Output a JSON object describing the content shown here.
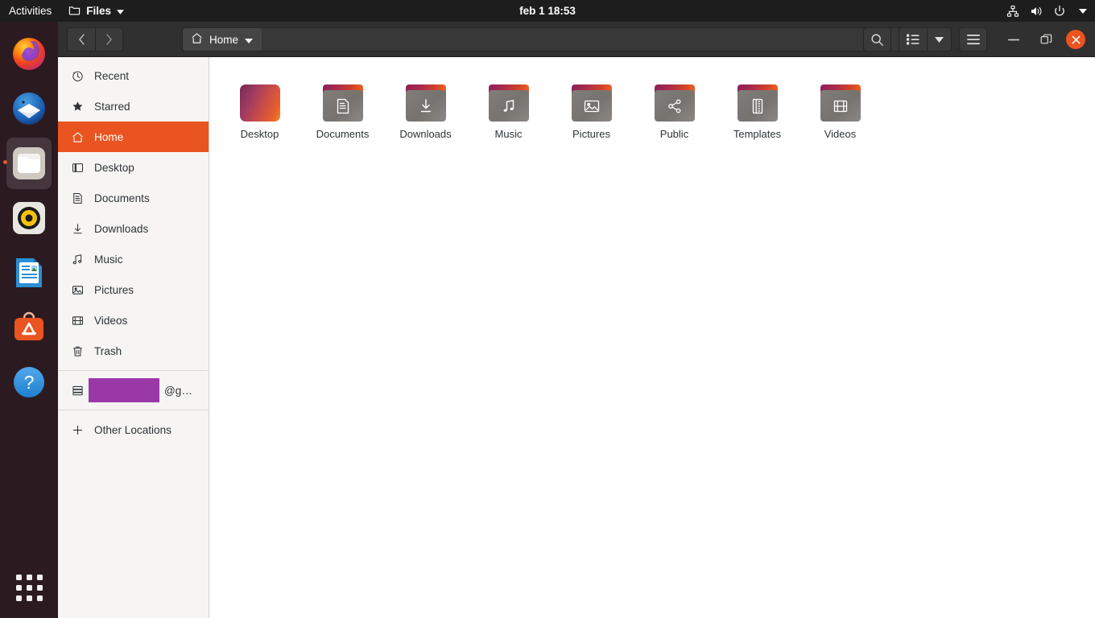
{
  "topbar": {
    "activities": "Activities",
    "app_name": "Files",
    "app_icon": "folder-icon",
    "app_menu_arrow": "chevron-down-icon",
    "clock": "feb 1  18:53",
    "tray": [
      {
        "name": "network-icon"
      },
      {
        "name": "volume-icon"
      },
      {
        "name": "power-icon"
      },
      {
        "name": "chevron-down-icon"
      }
    ]
  },
  "dock": {
    "items": [
      {
        "name": "firefox",
        "label": "Firefox",
        "active": false
      },
      {
        "name": "thunderbird",
        "label": "Thunderbird",
        "active": false
      },
      {
        "name": "files",
        "label": "Files",
        "active": true
      },
      {
        "name": "rhythmbox",
        "label": "Rhythmbox",
        "active": false
      },
      {
        "name": "libreoffice-writer",
        "label": "LibreOffice Writer",
        "active": false
      },
      {
        "name": "ubuntu-software",
        "label": "Ubuntu Software",
        "active": false
      },
      {
        "name": "help",
        "label": "Help",
        "active": false
      }
    ],
    "show_applications": "Show Applications"
  },
  "headerbar": {
    "back": "Back",
    "forward": "Forward",
    "breadcrumb": "Home",
    "breadcrumb_icon": "home-icon",
    "breadcrumb_arrow": "chevron-down-icon",
    "search": "Search",
    "view_list": "List view",
    "view_arrow": "View options",
    "menu": "Main menu",
    "minimize": "Minimize",
    "maximize": "Maximize",
    "close": "Close"
  },
  "sidebar": {
    "items": [
      {
        "label": "Recent",
        "icon": "clock-icon",
        "selected": false
      },
      {
        "label": "Starred",
        "icon": "star-icon",
        "selected": false
      },
      {
        "label": "Home",
        "icon": "home-icon",
        "selected": true
      },
      {
        "label": "Desktop",
        "icon": "desktop-icon",
        "selected": false
      },
      {
        "label": "Documents",
        "icon": "document-icon",
        "selected": false
      },
      {
        "label": "Downloads",
        "icon": "download-icon",
        "selected": false
      },
      {
        "label": "Music",
        "icon": "music-icon",
        "selected": false
      },
      {
        "label": "Pictures",
        "icon": "image-icon",
        "selected": false
      },
      {
        "label": "Videos",
        "icon": "video-icon",
        "selected": false
      },
      {
        "label": "Trash",
        "icon": "trash-icon",
        "selected": false
      }
    ],
    "mount": {
      "label": "@g…",
      "icon": "server-icon",
      "redacted": true
    },
    "other_locations": {
      "label": "Other Locations",
      "icon": "plus-icon"
    }
  },
  "files": [
    {
      "label": "Desktop",
      "type": "thumbnail",
      "emblem": ""
    },
    {
      "label": "Documents",
      "type": "folder",
      "emblem": "document-icon"
    },
    {
      "label": "Downloads",
      "type": "folder",
      "emblem": "download-icon"
    },
    {
      "label": "Music",
      "type": "folder",
      "emblem": "music-icon"
    },
    {
      "label": "Pictures",
      "type": "folder",
      "emblem": "image-icon"
    },
    {
      "label": "Public",
      "type": "folder",
      "emblem": "share-icon"
    },
    {
      "label": "Templates",
      "type": "folder",
      "emblem": "template-icon"
    },
    {
      "label": "Videos",
      "type": "folder",
      "emblem": "video-icon"
    }
  ],
  "colors": {
    "accent": "#e95420",
    "dock_bg": "#2c1a21",
    "topbar_bg": "#1d1d1d",
    "headerbar_bg": "#303030",
    "sidebar_bg": "#f6f5f4",
    "redaction": "#9b38a8"
  }
}
